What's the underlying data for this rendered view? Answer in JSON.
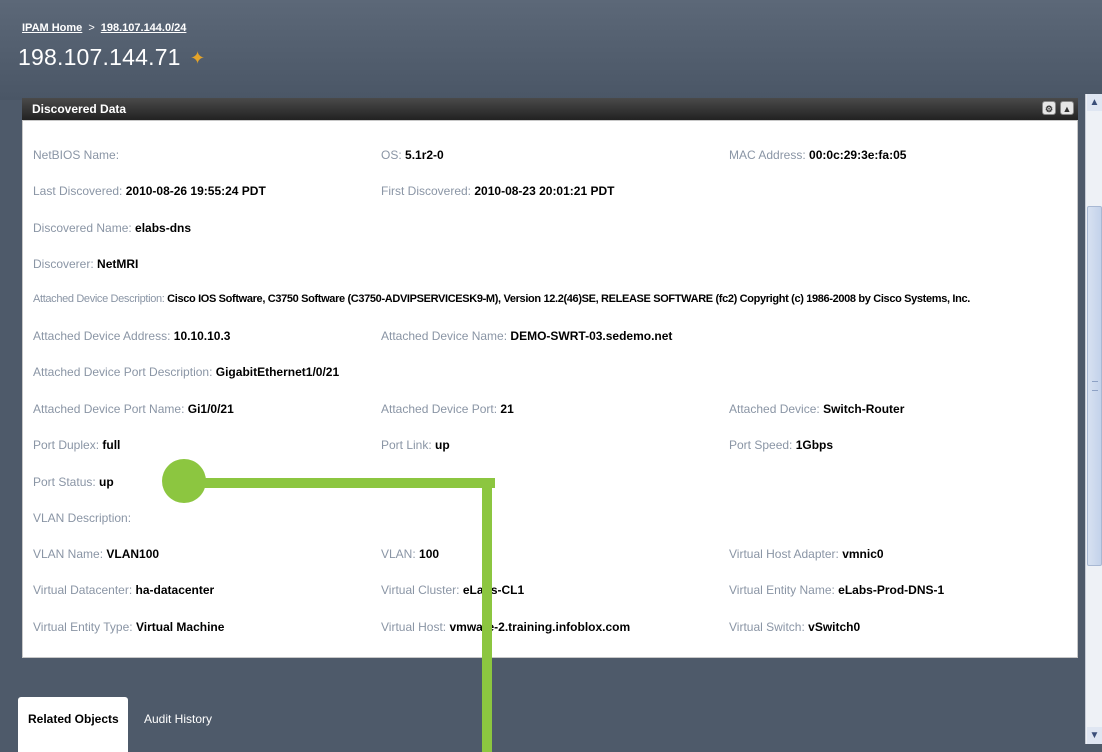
{
  "breadcrumb": {
    "home": "IPAM Home",
    "separator": ">",
    "network": "198.107.144.0/24"
  },
  "page_title": "198.107.144.71",
  "panel": {
    "title": "Discovered Data"
  },
  "fields": {
    "netbios_name": {
      "label": "NetBIOS Name:",
      "value": ""
    },
    "os": {
      "label": "OS:",
      "value": "5.1r2-0"
    },
    "mac_address": {
      "label": "MAC Address:",
      "value": "00:0c:29:3e:fa:05"
    },
    "last_discovered": {
      "label": "Last Discovered:",
      "value": "2010-08-26 19:55:24 PDT"
    },
    "first_discovered": {
      "label": "First Discovered:",
      "value": "2010-08-23 20:01:21 PDT"
    },
    "discovered_name": {
      "label": "Discovered Name:",
      "value": "elabs-dns"
    },
    "discoverer": {
      "label": "Discoverer:",
      "value": "NetMRI"
    },
    "attached_device_description": {
      "label": "Attached Device Description:",
      "value": "Cisco IOS Software, C3750 Software (C3750-ADVIPSERVICESK9-M), Version 12.2(46)SE, RELEASE SOFTWARE (fc2) Copyright (c) 1986-2008 by Cisco Systems, Inc."
    },
    "attached_device_address": {
      "label": "Attached Device Address:",
      "value": "10.10.10.3"
    },
    "attached_device_name": {
      "label": "Attached Device Name:",
      "value": "DEMO-SWRT-03.sedemo.net"
    },
    "attached_device_port_description": {
      "label": "Attached Device Port Description:",
      "value": "GigabitEthernet1/0/21"
    },
    "attached_device_port_name": {
      "label": "Attached Device Port Name:",
      "value": "Gi1/0/21"
    },
    "attached_device_port": {
      "label": "Attached Device Port:",
      "value": "21"
    },
    "attached_device": {
      "label": "Attached Device:",
      "value": "Switch-Router"
    },
    "port_duplex": {
      "label": "Port Duplex:",
      "value": "full"
    },
    "port_link": {
      "label": "Port Link:",
      "value": "up"
    },
    "port_speed": {
      "label": "Port Speed:",
      "value": "1Gbps"
    },
    "port_status": {
      "label": "Port Status:",
      "value": "up"
    },
    "vlan_description": {
      "label": "VLAN Description:",
      "value": ""
    },
    "vlan_name": {
      "label": "VLAN Name:",
      "value": "VLAN100"
    },
    "vlan": {
      "label": "VLAN:",
      "value": "100"
    },
    "virtual_host_adapter": {
      "label": "Virtual Host Adapter:",
      "value": "vmnic0"
    },
    "virtual_datacenter": {
      "label": "Virtual Datacenter:",
      "value": "ha-datacenter"
    },
    "virtual_cluster": {
      "label": "Virtual Cluster:",
      "value": "eLabs-CL1"
    },
    "virtual_entity_name": {
      "label": "Virtual Entity Name:",
      "value": "eLabs-Prod-DNS-1"
    },
    "virtual_entity_type": {
      "label": "Virtual Entity Type:",
      "value": "Virtual Machine"
    },
    "virtual_host": {
      "label": "Virtual Host:",
      "value": "vmware-2.training.infoblox.com"
    },
    "virtual_switch": {
      "label": "Virtual Switch:",
      "value": "vSwitch0"
    }
  },
  "tabs": [
    {
      "label": "Related Objects"
    },
    {
      "label": "Audit History"
    }
  ],
  "icons": {
    "title_icon": "star-icon",
    "panel_gear": "gear-icon",
    "panel_collapse": "chevron-up-icon",
    "scroll_up": "chevron-up-icon",
    "scroll_down": "chevron-down-icon"
  },
  "colors": {
    "background": "#4e5a6a",
    "panel_header": "#222222",
    "field_label": "#8a95a5",
    "callout": "#8cc640"
  }
}
